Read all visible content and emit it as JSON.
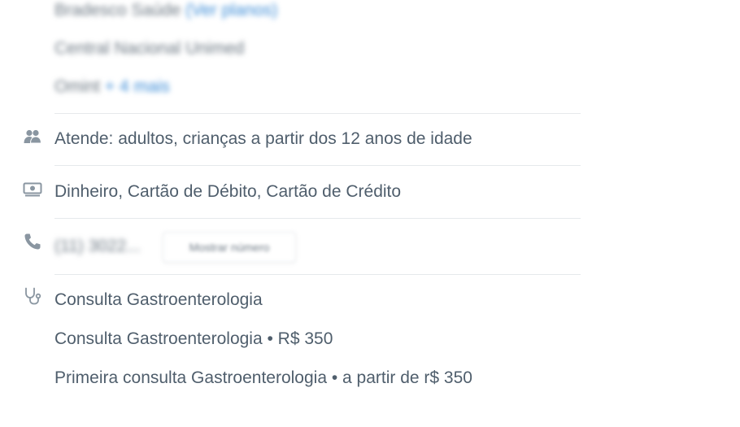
{
  "insurances": {
    "items": [
      "Bradesco Saúde",
      "Central Nacional Unimed",
      "Omint"
    ],
    "plans_link": "(Ver planos)",
    "more_link": "+ 4 mais"
  },
  "audience": {
    "icon": "people-icon",
    "text": "Atende: adultos, crianças a partir dos 12 anos de idade"
  },
  "payment": {
    "icon": "cash-icon",
    "text": "Dinheiro, Cartão de Débito, Cartão de Crédito"
  },
  "phone": {
    "icon": "phone-icon",
    "masked_number": "(11) 3022...",
    "show_button_label": "Mostrar número"
  },
  "services": {
    "icon": "stethoscope-icon",
    "items": [
      "Consulta Gastroenterologia",
      "Consulta Gastroenterologia • R$ 350",
      "Primeira consulta Gastroenterologia • a partir de r$ 350"
    ]
  },
  "colors": {
    "text": "#4f5e6c",
    "link": "#3a8bd6",
    "divider": "#e6e9ec",
    "icon": "#8a96a1"
  }
}
